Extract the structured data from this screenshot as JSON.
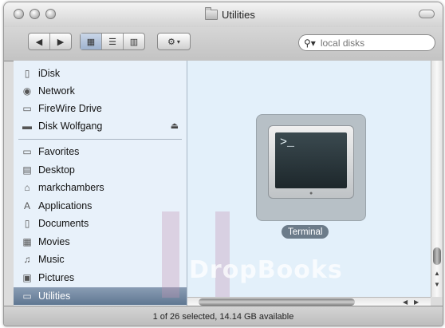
{
  "window": {
    "title": "Utilities"
  },
  "search": {
    "placeholder": "local disks"
  },
  "sidebar": {
    "devices": [
      {
        "label": "iDisk",
        "icon": "idisk-icon"
      },
      {
        "label": "Network",
        "icon": "network-icon"
      },
      {
        "label": "FireWire Drive",
        "icon": "drive-icon"
      },
      {
        "label": "Disk Wolfgang",
        "icon": "disk-icon"
      }
    ],
    "places": [
      {
        "label": "Favorites",
        "icon": "folder-icon"
      },
      {
        "label": "Desktop",
        "icon": "desktop-icon"
      },
      {
        "label": "markchambers",
        "icon": "home-icon"
      },
      {
        "label": "Applications",
        "icon": "applications-icon"
      },
      {
        "label": "Documents",
        "icon": "documents-icon"
      },
      {
        "label": "Movies",
        "icon": "movies-icon"
      },
      {
        "label": "Music",
        "icon": "music-icon"
      },
      {
        "label": "Pictures",
        "icon": "pictures-icon"
      },
      {
        "label": "Utilities",
        "icon": "folder-icon"
      }
    ]
  },
  "content": {
    "item_label": "Terminal",
    "prompt": ">_"
  },
  "status": {
    "text": "1 of 26 selected, 14.14 GB available"
  },
  "watermark": {
    "text": "DropBooks"
  },
  "colors": {
    "selection": "#6f86a0",
    "sidebar_bg": "#e8f1fa",
    "content_bg": "#e3f0fa"
  }
}
